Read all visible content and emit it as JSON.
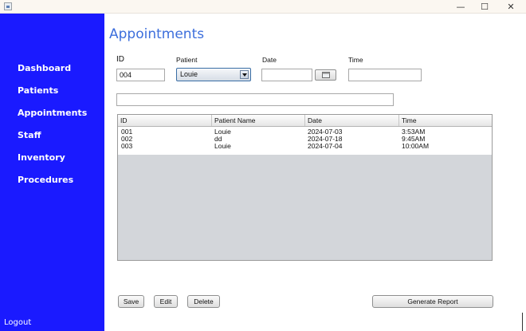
{
  "window": {
    "minimize_glyph": "—",
    "maximize_glyph": "☐",
    "close_glyph": "✕"
  },
  "sidebar": {
    "items": [
      {
        "label": "Dashboard"
      },
      {
        "label": "Patients"
      },
      {
        "label": "Appointments"
      },
      {
        "label": "Staff"
      },
      {
        "label": "Inventory"
      },
      {
        "label": "Procedures"
      }
    ],
    "logout_label": "Logout"
  },
  "page": {
    "title": "Appointments"
  },
  "form": {
    "id_label": "ID",
    "id_value": "004",
    "patient_label": "Patient",
    "patient_value": "Louie",
    "date_label": "Date",
    "date_value": "",
    "time_label": "Time",
    "time_value": "",
    "search_value": ""
  },
  "table": {
    "columns": [
      "ID",
      "Patient Name",
      "Date",
      "Time"
    ],
    "rows": [
      [
        "001",
        "Louie",
        "2024-07-03",
        "3:53AM"
      ],
      [
        "002",
        "dd",
        "2024-07-18",
        "9:45AM"
      ],
      [
        "003",
        "Louie",
        "2024-07-04",
        "10:00AM"
      ]
    ]
  },
  "actions": {
    "save_label": "Save",
    "edit_label": "Edit",
    "delete_label": "Delete",
    "report_label": "Generate Report"
  },
  "colors": {
    "sidebar": "#1a1aff",
    "title": "#3d6fdc",
    "table_bg": "#d3d6da"
  }
}
